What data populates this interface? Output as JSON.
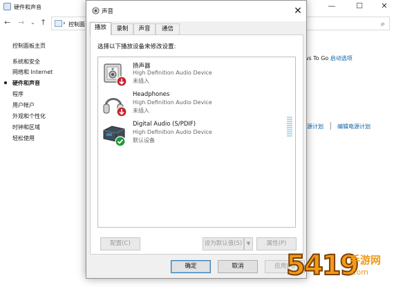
{
  "control_panel": {
    "window_title": "硬件和声音",
    "address": "控制面",
    "sidebar": {
      "home": "控制面板主页",
      "items": [
        "系统和安全",
        "网络和 Internet",
        "硬件和声音",
        "程序",
        "用户帐户",
        "外观和个性化",
        "时钟和区域",
        "轻松使用"
      ]
    },
    "right_text_prefix": "ws To Go",
    "right_link": "启动选项",
    "right_links_row": [
      "源计划",
      "编辑电源计划"
    ]
  },
  "sound_dialog": {
    "title": "声音",
    "tabs": [
      "播放",
      "录制",
      "声音",
      "通信"
    ],
    "active_tab": 0,
    "instruction": "选择以下播放设备来修改设置:",
    "devices": [
      {
        "name": "扬声器",
        "description": "High Definition Audio Device",
        "status": "未插入",
        "icon": "speaker-icon",
        "badge": "unplugged-arrow-badge"
      },
      {
        "name": "Headphones",
        "description": "High Definition Audio Device",
        "status": "未插入",
        "icon": "headphones-icon",
        "badge": "unplugged-arrow-badge"
      },
      {
        "name": "Digital Audio (S/PDIF)",
        "description": "High Definition Audio Device",
        "status": "默认设备",
        "icon": "spdif-device-icon",
        "badge": "default-check-badge"
      }
    ],
    "buttons": {
      "configure": "配置(C)",
      "set_default": "设为默认值(S)",
      "properties": "属性(P)",
      "ok": "确定",
      "cancel": "取消",
      "apply": "应用(A)"
    }
  },
  "watermark": {
    "number": "5419",
    "text": "手游网",
    "url": ".com"
  },
  "colors": {
    "link": "#0b61a4",
    "accent": "#3c7fb1",
    "badge_red": "#c4262e",
    "badge_green": "#1f9a3a",
    "watermark": "#f29a17"
  }
}
